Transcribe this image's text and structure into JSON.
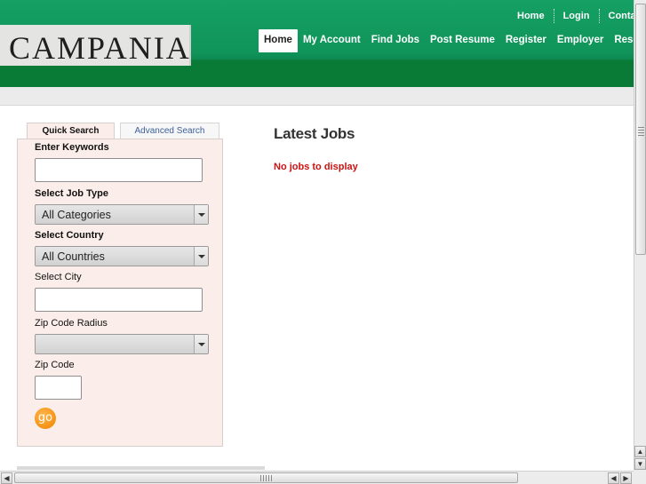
{
  "brand": {
    "logo_text": "CAMPANIA"
  },
  "top_links": [
    "Home",
    "Login",
    "Contact"
  ],
  "nav": {
    "items": [
      "Home",
      "My Account",
      "Find Jobs",
      "Post Resume",
      "Register",
      "Employer",
      "Resources"
    ],
    "active": "Home"
  },
  "search": {
    "tabs": {
      "quick": "Quick Search",
      "advanced": "Advanced Search"
    },
    "keywords_label": "Enter Keywords",
    "job_type_label": "Select Job Type",
    "job_type_value": "All Categories",
    "country_label": "Select Country",
    "country_value": "All Countries",
    "city_label": "Select City",
    "radius_label": "Zip Code Radius",
    "radius_value": "",
    "zip_label": "Zip Code",
    "go_label": "go"
  },
  "content": {
    "title": "Latest Jobs",
    "empty_message": "No jobs to display"
  },
  "colors": {
    "header_green": "#10945a",
    "accent_red": "#cc1111",
    "panel_bg": "#fbeeea",
    "go_orange": "#f08400"
  }
}
